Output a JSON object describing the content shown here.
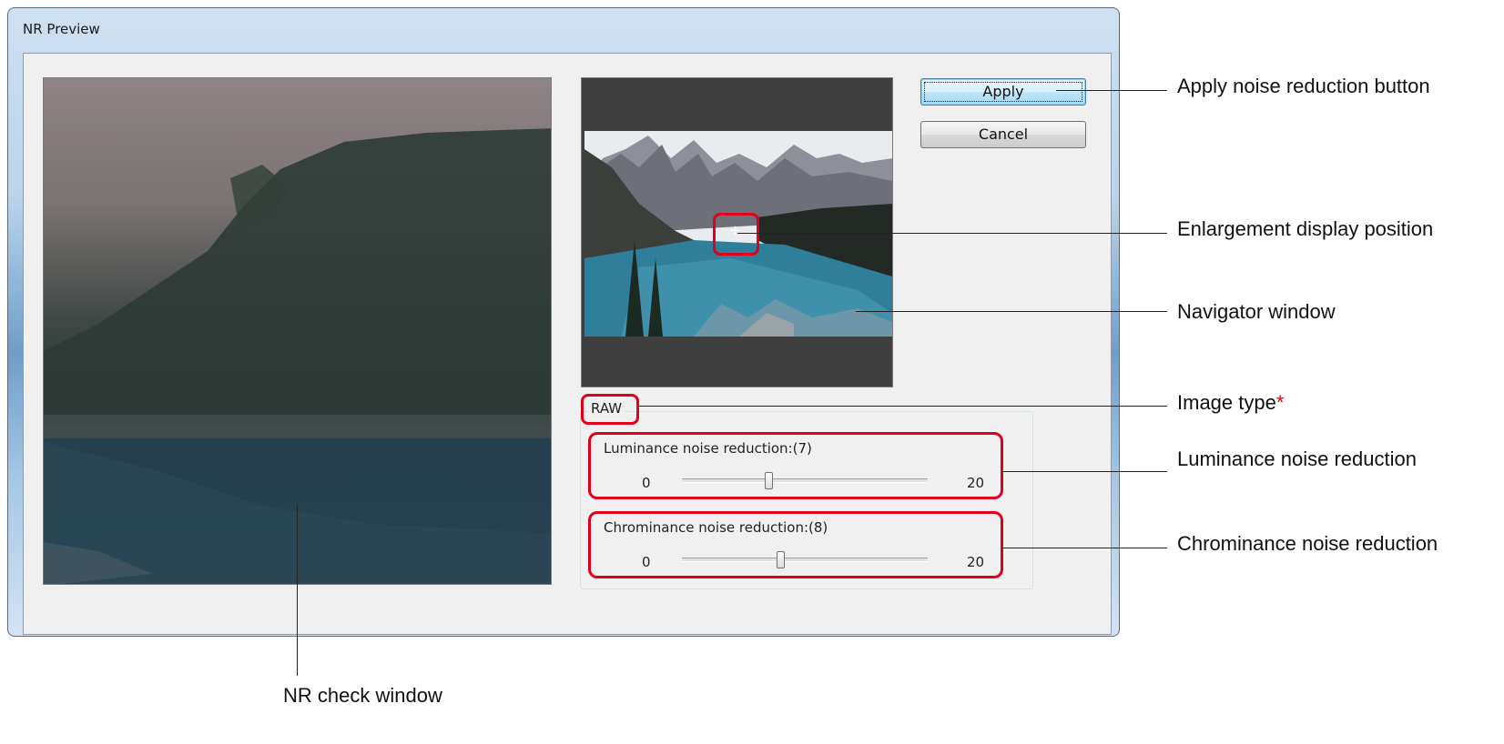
{
  "window": {
    "title": "NR Preview"
  },
  "buttons": {
    "apply_label": "Apply",
    "cancel_label": "Cancel"
  },
  "image_type": "RAW",
  "luminance": {
    "label": "Luminance noise reduction:(7)",
    "min": "0",
    "max": "20",
    "value": 7
  },
  "chrominance": {
    "label": "Chrominance noise reduction:(8)",
    "min": "0",
    "max": "20",
    "value": 8
  },
  "navigator": {
    "crosshair_glyph": "+"
  },
  "callouts": {
    "apply": "Apply noise reduction button",
    "enlargement": "Enlargement display position",
    "navigator": "Navigator window",
    "image_type": "Image type",
    "image_type_mark": "*",
    "luminance": "Luminance noise reduction",
    "chrominance": "Chrominance noise reduction",
    "nr_check": "NR check window"
  },
  "colors": {
    "highlight_red": "#e0001b",
    "callout_asterisk": "#e0001b"
  }
}
